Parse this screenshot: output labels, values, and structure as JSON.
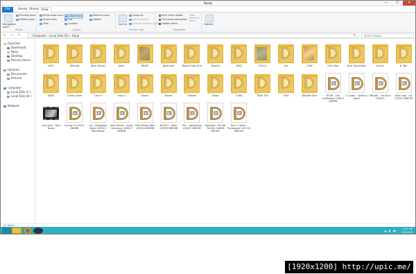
{
  "window": {
    "title": "Kpop",
    "min": "—",
    "max": "☐",
    "close": "✕"
  },
  "menu": {
    "file": "File",
    "home": "Home",
    "share": "Share",
    "view": "View"
  },
  "ribbon": {
    "panes": {
      "nav_pane": "Navigation pane",
      "preview": "Preview pane",
      "details_pane": "Details pane",
      "group": "Panes"
    },
    "layout": {
      "extra_large": "Extra large icons",
      "large": "Large icons",
      "medium": "Medium icons",
      "small": "Small icons",
      "list": "List",
      "details": "Details",
      "tiles": "Tiles",
      "content": "Content",
      "group": "Layout"
    },
    "current_view": {
      "sort": "Sort by",
      "group_by": "Group by",
      "add_columns": "Add columns",
      "size_cols": "Size all columns to fit",
      "group": "Current view"
    },
    "show_hide": {
      "item_checkboxes": "Item check boxes",
      "extensions": "File name extensions",
      "hidden": "Hidden items",
      "hide_selected": "Hide selected items",
      "group": "Show/hide"
    },
    "options": "Options"
  },
  "address": {
    "path": "›  Computer  ›  Local Disk (D:)  ›  Kpop",
    "search_placeholder": "Search Kpop",
    "back": "←",
    "forward": "→",
    "up": "↑",
    "refresh": "↻"
  },
  "nav": {
    "favorites": "Favorites",
    "downloads": "Downloads",
    "kpop": "Kpop",
    "desktop": "Desktop",
    "recent": "Recent places",
    "libraries": "Libraries",
    "documents": "Documents",
    "pictures": "Pictures",
    "computer": "Computer",
    "disk_c": "Local Disk (C:)",
    "disk_d": "Local Disk (D:)",
    "network": "Network"
  },
  "items": [
    {
      "name": "2NE1",
      "kind": "folder"
    },
    {
      "name": "4Minute",
      "kind": "folder"
    },
    {
      "name": "After School",
      "kind": "folder"
    },
    {
      "name": "Ailee",
      "kind": "folder"
    },
    {
      "name": "BEAST",
      "kind": "folder-photo"
    },
    {
      "name": "Boyfriend",
      "kind": "folder"
    },
    {
      "name": "Brown Eyed Girls",
      "kind": "folder"
    },
    {
      "name": "Davichi",
      "kind": "folder"
    },
    {
      "name": "EXID",
      "kind": "folder"
    },
    {
      "name": "EXO-K",
      "kind": "folder-photo2"
    },
    {
      "name": "f(x)",
      "kind": "folder"
    },
    {
      "name": "G.NA",
      "kind": "folder-photo3"
    },
    {
      "name": "Girl's Day",
      "kind": "folder"
    },
    {
      "name": "Girls' Generation",
      "kind": "folder"
    },
    {
      "name": "HyunA",
      "kind": "folder"
    },
    {
      "name": "K. Will",
      "kind": "folder"
    },
    {
      "name": "KARA",
      "kind": "folder"
    },
    {
      "name": "Lesley Code",
      "kind": "folder"
    },
    {
      "name": "Lee Hi",
      "kind": "folder"
    },
    {
      "name": "miss A",
      "kind": "folder"
    },
    {
      "name": "Rania",
      "kind": "folder"
    },
    {
      "name": "Secret",
      "kind": "folder"
    },
    {
      "name": "SHINee",
      "kind": "folder"
    },
    {
      "name": "Sistar",
      "kind": "folder"
    },
    {
      "name": "T-ARA",
      "kind": "folder"
    },
    {
      "name": "TEEN TOP",
      "kind": "folder"
    },
    {
      "name": "VIXX",
      "kind": "folder"
    },
    {
      "name": "Wonder Girls",
      "kind": "folder"
    },
    {
      "name": "BTOB - 2nd Confession 130917 KBSMB",
      "kind": "video"
    },
    {
      "name": "C-Clown - Shaking Heart",
      "kind": "video"
    },
    {
      "name": "UNIQUE - I'm Sorry 150220",
      "kind": "video"
    },
    {
      "name": "Epik High - Up 121201 MBCGD",
      "kind": "video"
    },
    {
      "name": "Lee Hyori - Miss Korea",
      "kind": "film"
    },
    {
      "name": "Loving U 121021 KBSMB",
      "kind": "video"
    },
    {
      "name": "Lyn - Breakable Heart 130511 Sketchbook",
      "kind": "video"
    },
    {
      "name": "Nine Muses - Adult Ceremony 130617 KBSMB",
      "kind": "video"
    },
    {
      "name": "Nine Muses Wild 130510 KBSMB",
      "kind": "video"
    },
    {
      "name": "NU'EST - Hello 130507 KBSMB",
      "kind": "video"
    },
    {
      "name": "PSY - Gentleman 130427 MBCMC",
      "kind": "video"
    },
    {
      "name": "Rainbow - Tell Me Tell Me 130808 MBCMC",
      "kind": "video"
    },
    {
      "name": "Rich 2 Home - Rundaway! 121231 MBCGD",
      "kind": "video"
    }
  ],
  "status": {
    "count": "41 items"
  },
  "taskbar": {
    "time": "2:02 AM",
    "date": "3/1/2015",
    "tray": "▲ ▮ ◀)"
  },
  "watermark": "[1920x1200] http://upic.me/"
}
